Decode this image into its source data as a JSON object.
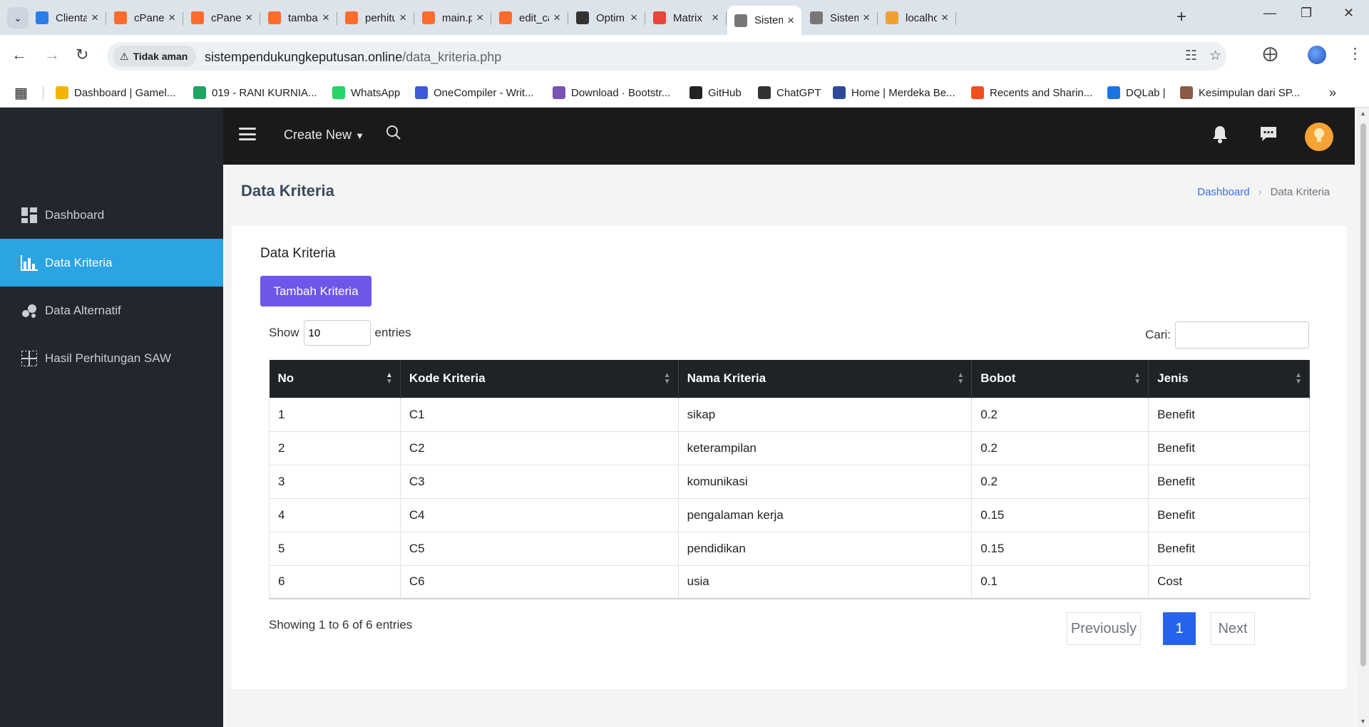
{
  "browser": {
    "tabs": [
      {
        "title": "Clienta",
        "icon": "clientarea-icon",
        "color": "#2b7de9"
      },
      {
        "title": "cPanel",
        "icon": "cpanel-icon",
        "color": "#ff6c2c"
      },
      {
        "title": "cPanel",
        "icon": "cpanel-icon",
        "color": "#ff6c2c"
      },
      {
        "title": "tambal",
        "icon": "cpanel-icon",
        "color": "#ff6c2c"
      },
      {
        "title": "perhitu",
        "icon": "cpanel-icon",
        "color": "#ff6c2c"
      },
      {
        "title": "main.p",
        "icon": "cpanel-icon",
        "color": "#ff6c2c"
      },
      {
        "title": "edit_ca",
        "icon": "cpanel-icon",
        "color": "#ff6c2c"
      },
      {
        "title": "Optim",
        "icon": "chatgpt-icon",
        "color": "#333333"
      },
      {
        "title": "Matrix",
        "icon": "matrix-icon",
        "color": "#e8453c"
      },
      {
        "title": "Sistem",
        "icon": "page-icon",
        "color": "#777777",
        "active": true
      },
      {
        "title": "Sistem",
        "icon": "page-icon",
        "color": "#777777"
      },
      {
        "title": "localhc",
        "icon": "phpmyadmin-icon",
        "color": "#f0a030"
      }
    ],
    "security_label": "Tidak aman",
    "url_host": "sistempendukungkeputusan.online",
    "url_path": "/data_kriteria.php",
    "bookmarks": [
      {
        "label": "Dashboard | Gamel...",
        "icon": "gamelab-icon",
        "color": "#f5b400"
      },
      {
        "label": "019 - RANI KURNIA...",
        "icon": "drive-icon",
        "color": "#1fa463"
      },
      {
        "label": "WhatsApp",
        "icon": "whatsapp-icon",
        "color": "#25d366"
      },
      {
        "label": "OneCompiler - Writ...",
        "icon": "onecompiler-icon",
        "color": "#3b5bdb"
      },
      {
        "label": "Download · Bootstr...",
        "icon": "bootstrap-icon",
        "color": "#7952b3"
      },
      {
        "label": "GitHub",
        "icon": "github-icon",
        "color": "#222222"
      },
      {
        "label": "ChatGPT",
        "icon": "chatgpt-icon",
        "color": "#333333"
      },
      {
        "label": "Home | Merdeka Be...",
        "icon": "merdeka-icon",
        "color": "#2d4a9a"
      },
      {
        "label": "Recents and Sharin...",
        "icon": "figma-icon",
        "color": "#f24e1e"
      },
      {
        "label": "DQLab |",
        "icon": "dqlab-icon",
        "color": "#1b74e4"
      },
      {
        "label": "Kesimpulan dari SP...",
        "icon": "kesimpulan-icon",
        "color": "#8a5a44"
      }
    ]
  },
  "sidebar": {
    "items": [
      {
        "label": "Dashboard",
        "icon": "dashboard-icon",
        "active": false
      },
      {
        "label": "Data Kriteria",
        "icon": "bar-chart-icon",
        "active": true
      },
      {
        "label": "Data Alternatif",
        "icon": "bubbles-icon",
        "active": false
      },
      {
        "label": "Hasil Perhitungan SAW",
        "icon": "grid-icon",
        "active": false
      }
    ]
  },
  "topnav": {
    "create_new": "Create New"
  },
  "page": {
    "title": "Data Kriteria",
    "breadcrumb": [
      "Dashboard",
      "Data Kriteria"
    ]
  },
  "card": {
    "title": "Data Kriteria",
    "add_button": "Tambah Kriteria",
    "show_label": "Show",
    "entries_value": "10",
    "entries_label": "entries",
    "search_label": "Cari:",
    "columns": [
      "No",
      "Kode Kriteria",
      "Nama Kriteria",
      "Bobot",
      "Jenis"
    ],
    "rows": [
      [
        "1",
        "C1",
        "sikap",
        "0.2",
        "Benefit"
      ],
      [
        "2",
        "C2",
        "keterampilan",
        "0.2",
        "Benefit"
      ],
      [
        "3",
        "C3",
        "komunikasi",
        "0.2",
        "Benefit"
      ],
      [
        "4",
        "C4",
        "pengalaman kerja",
        "0.15",
        "Benefit"
      ],
      [
        "5",
        "C5",
        "pendidikan",
        "0.15",
        "Benefit"
      ],
      [
        "6",
        "C6",
        "usia",
        "0.1",
        "Cost"
      ]
    ],
    "info": "Showing 1 to 6 of 6 entries",
    "pagination": {
      "previous": "Previously",
      "current": "1",
      "next": "Next"
    }
  },
  "colors": {
    "sidebar_bg": "#22272e",
    "sidebar_active": "#2aa4e3",
    "topnav_bg": "#1a1a1a",
    "add_button": "#6f55e8",
    "page_active": "#2563eb",
    "avatar": "#f7a234"
  }
}
